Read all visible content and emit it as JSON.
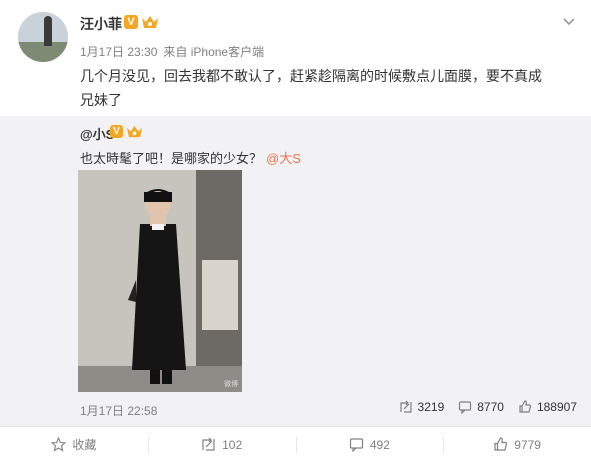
{
  "post": {
    "author": "汪小菲",
    "verified_badge": "V",
    "date": "1月17日 23:30",
    "source": "来自 iPhone客户端",
    "text": "几个月没见，回去我都不敢认了，赶紧趁隔离的时候敷点儿面膜，要不真成兄妹了"
  },
  "repost": {
    "author": "@小S",
    "verified_badge": "V",
    "text": "也太時髦了吧！是哪家的少女？",
    "mention": "@大S",
    "time": "1月17日 22:58",
    "stats": {
      "reposts": "3219",
      "comments": "8770",
      "likes": "188907"
    },
    "photo_watermark": "微博"
  },
  "actions": {
    "favorite": "收藏",
    "repost": "102",
    "comment": "492",
    "like": "9779"
  },
  "colors": {
    "badge": "#f5a623",
    "mention": "#eb7350",
    "repost_bg": "#f2f2f5",
    "meta_gray": "#808080"
  },
  "icons": [
    "chevron-down-icon",
    "crown-icon",
    "repost-icon",
    "comment-icon",
    "like-icon",
    "favorite-icon"
  ]
}
